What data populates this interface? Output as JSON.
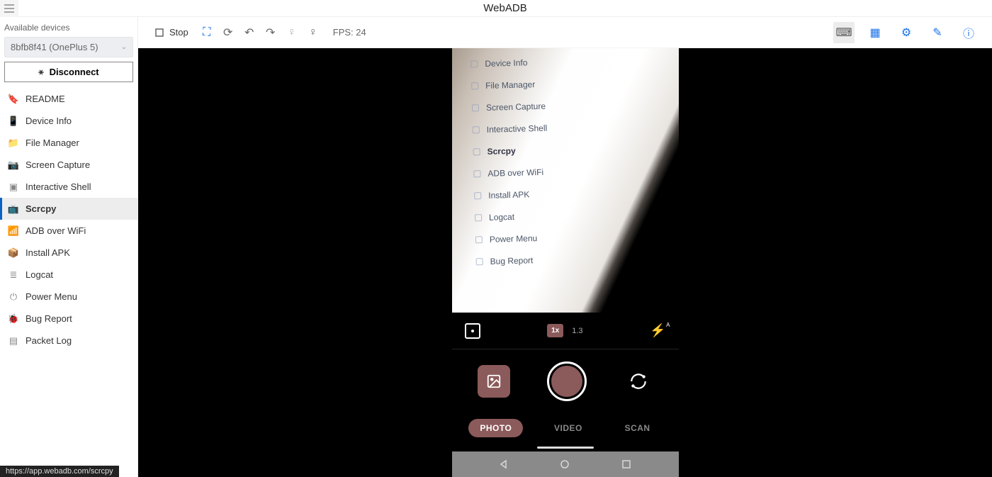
{
  "header": {
    "title": "WebADB"
  },
  "sidebar": {
    "header": "Available devices",
    "device": "8bfb8f41 (OnePlus 5)",
    "disconnect": "Disconnect",
    "items": [
      {
        "label": "README",
        "icon": "bookmark-icon"
      },
      {
        "label": "Device Info",
        "icon": "phone-icon"
      },
      {
        "label": "File Manager",
        "icon": "folder-icon"
      },
      {
        "label": "Screen Capture",
        "icon": "camera-icon"
      },
      {
        "label": "Interactive Shell",
        "icon": "terminal-icon"
      },
      {
        "label": "Scrcpy",
        "icon": "cast-icon",
        "selected": true
      },
      {
        "label": "ADB over WiFi",
        "icon": "wifi-icon"
      },
      {
        "label": "Install APK",
        "icon": "package-icon"
      },
      {
        "label": "Logcat",
        "icon": "log-icon"
      },
      {
        "label": "Power Menu",
        "icon": "power-icon"
      },
      {
        "label": "Bug Report",
        "icon": "bug-icon"
      },
      {
        "label": "Packet Log",
        "icon": "packet-icon"
      }
    ]
  },
  "toolbar": {
    "stop": "Stop",
    "fps_label": "FPS:",
    "fps_value": "24"
  },
  "phone_camera": {
    "viewfinder_list": [
      "Device Info",
      "File Manager",
      "Screen Capture",
      "Interactive Shell",
      "Scrcpy",
      "ADB over WiFi",
      "Install APK",
      "Logcat",
      "Power Menu",
      "Bug Report"
    ],
    "zoom_active": "1x",
    "zoom_alt": "1.3",
    "modes": {
      "photo": "PHOTO",
      "video": "VIDEO",
      "scan": "SCAN"
    }
  },
  "status_url": "https://app.webadb.com/scrcpy"
}
